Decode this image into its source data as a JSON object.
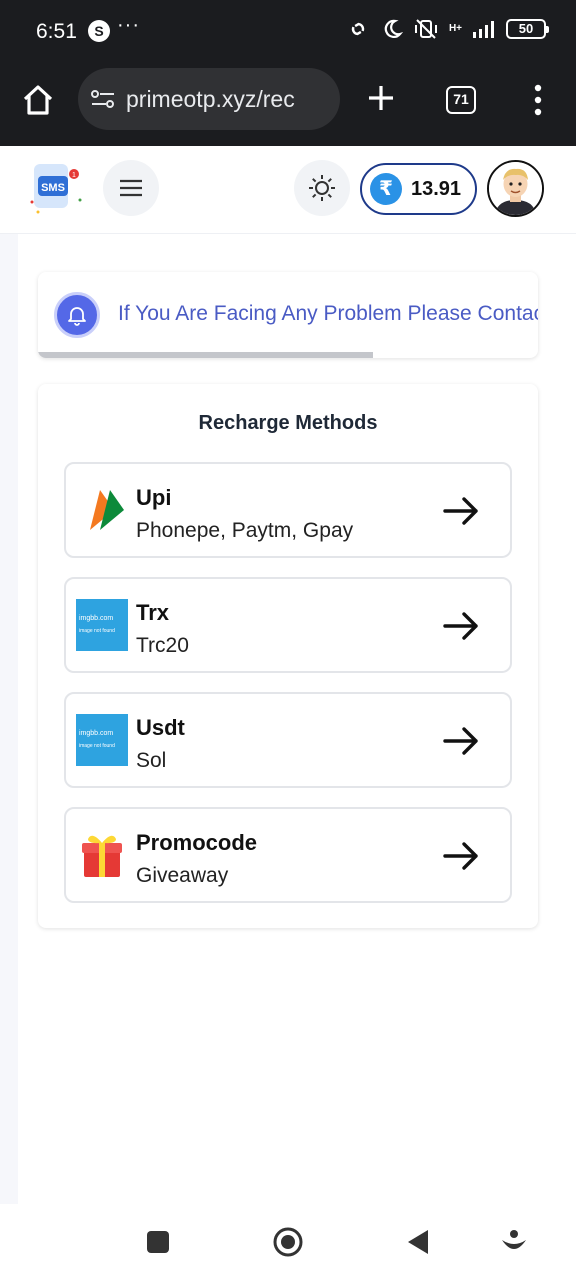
{
  "status_bar": {
    "time": "6:51",
    "app_badge": "S",
    "more": "···",
    "network": "H+",
    "battery": "50"
  },
  "browser": {
    "url": "primeotp.xyz/rec",
    "tab_count": "71"
  },
  "header": {
    "balance": "13.91",
    "currency_symbol": "₹"
  },
  "notice": {
    "text": "If You Are Facing Any Problem Please Contact",
    "progress": 0.67
  },
  "recharge": {
    "title": "Recharge Methods",
    "methods": [
      {
        "name": "Upi",
        "subtitle": "Phonepe, Paytm, Gpay",
        "icon": "upi-icon"
      },
      {
        "name": "Trx",
        "subtitle": "Trc20",
        "icon": "imgbb-placeholder",
        "placeholder_title": "imgbb.com",
        "placeholder_text": "image not found"
      },
      {
        "name": "Usdt",
        "subtitle": "Sol",
        "icon": "imgbb-placeholder",
        "placeholder_title": "imgbb.com",
        "placeholder_text": "image not found"
      },
      {
        "name": "Promocode",
        "subtitle": "Giveaway",
        "icon": "gift-icon"
      }
    ]
  },
  "colors": {
    "accent": "#2a92e6",
    "border_blue": "#1e3a8a",
    "notice_text": "#4a5bc4",
    "bell": "#5468e7"
  }
}
